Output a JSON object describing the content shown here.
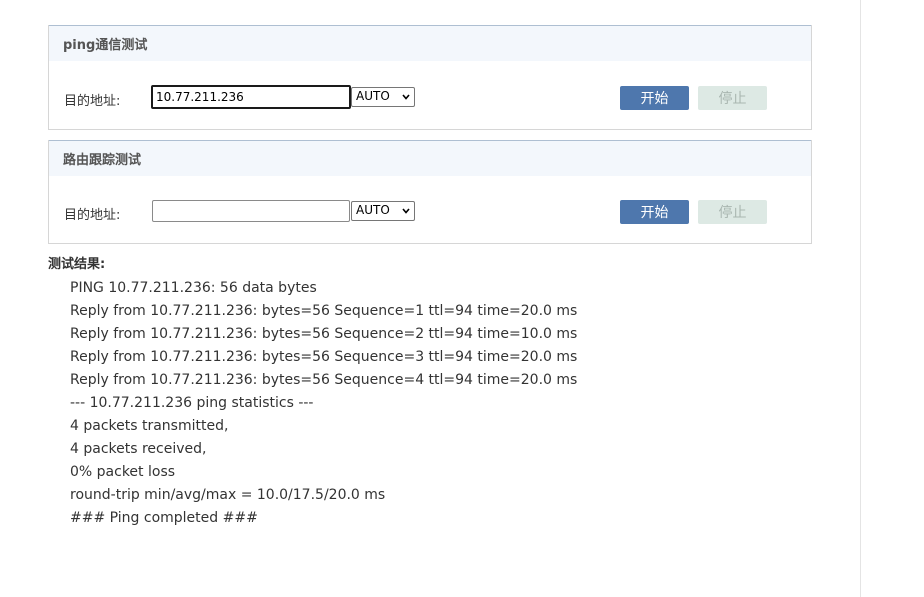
{
  "ping_panel": {
    "title": "ping通信测试",
    "address_label": "目的地址:",
    "address_value": "10.77.211.236",
    "protocol_selected": "AUTO",
    "start_label": "开始",
    "stop_label": "停止"
  },
  "trace_panel": {
    "title": "路由跟踪测试",
    "address_label": "目的地址:",
    "address_value": "",
    "protocol_selected": "AUTO",
    "start_label": "开始",
    "stop_label": "停止"
  },
  "results": {
    "title": "测试结果:",
    "lines": [
      "PING 10.77.211.236: 56 data bytes",
      "Reply from 10.77.211.236: bytes=56 Sequence=1 ttl=94 time=20.0 ms",
      "Reply from 10.77.211.236: bytes=56 Sequence=2 ttl=94 time=10.0 ms",
      "Reply from 10.77.211.236: bytes=56 Sequence=3 ttl=94 time=20.0 ms",
      "Reply from 10.77.211.236: bytes=56 Sequence=4 ttl=94 time=20.0 ms",
      "--- 10.77.211.236 ping statistics ---",
      "4 packets transmitted,",
      "4 packets received,",
      "0% packet loss",
      "round-trip min/avg/max = 10.0/17.5/20.0 ms",
      "### Ping completed ###"
    ]
  },
  "colors": {
    "start_button": "#4e77ad",
    "stop_button": "#dde9e4",
    "panel_header_bg": "#f3f7fc"
  },
  "icons": {
    "select_arrow": "chevron-down-icon"
  }
}
